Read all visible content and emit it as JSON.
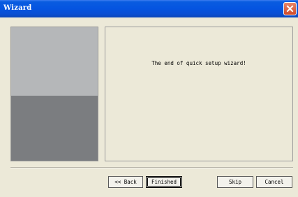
{
  "window": {
    "title": "Wizard"
  },
  "content": {
    "message": "The end of quick setup wizard!"
  },
  "buttons": {
    "back": "<< Back",
    "finished": "Finished",
    "skip": "Skip",
    "cancel": "Cancel"
  },
  "icons": {
    "close": "close-icon"
  },
  "colors": {
    "titlebar": "#0554e0",
    "panel_top": "#b5b7b9",
    "panel_bottom": "#7b7d80",
    "background": "#ece9d8"
  }
}
